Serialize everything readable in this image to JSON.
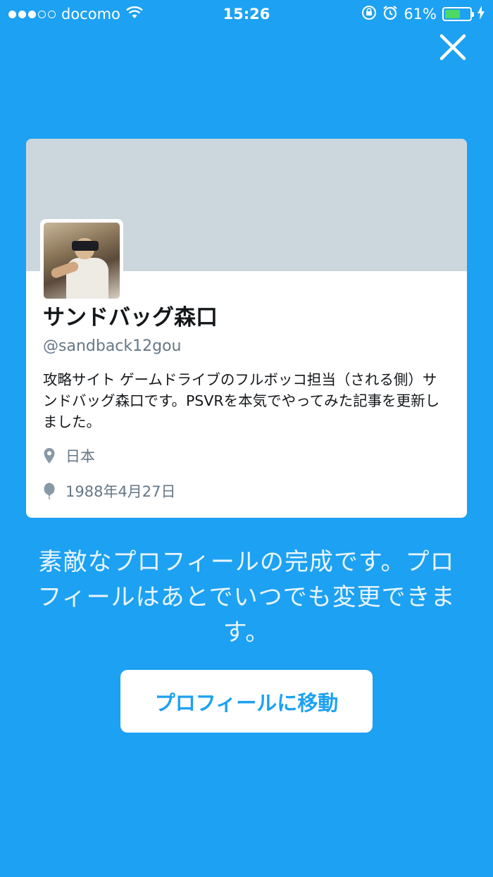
{
  "status_bar": {
    "carrier": "docomo",
    "time": "15:26",
    "battery_percent": "61%",
    "battery_level": 0.61,
    "signal_bars_filled": 3,
    "signal_bars_total": 5
  },
  "profile": {
    "name": "サンドバッグ森口",
    "handle": "@sandback12gou",
    "bio": "攻略サイト ゲームドライブのフルボッコ担当（される側）サンドバッグ森口です。PSVRを本気でやってみた記事を更新しました。",
    "location": "日本",
    "birthday": "1988年4月27日"
  },
  "message": "素敵なプロフィールの完成です。プロフィールはあとでいつでも変更できます。",
  "goto_button_label": "プロフィールに移動",
  "colors": {
    "background": "#1da1f2",
    "banner": "#ccd6dd",
    "battery": "#4cd964"
  },
  "icons": [
    "wifi-icon",
    "orientation-lock-icon",
    "alarm-icon",
    "charging-bolt-icon",
    "close-icon",
    "location-pin-icon",
    "balloon-icon"
  ]
}
